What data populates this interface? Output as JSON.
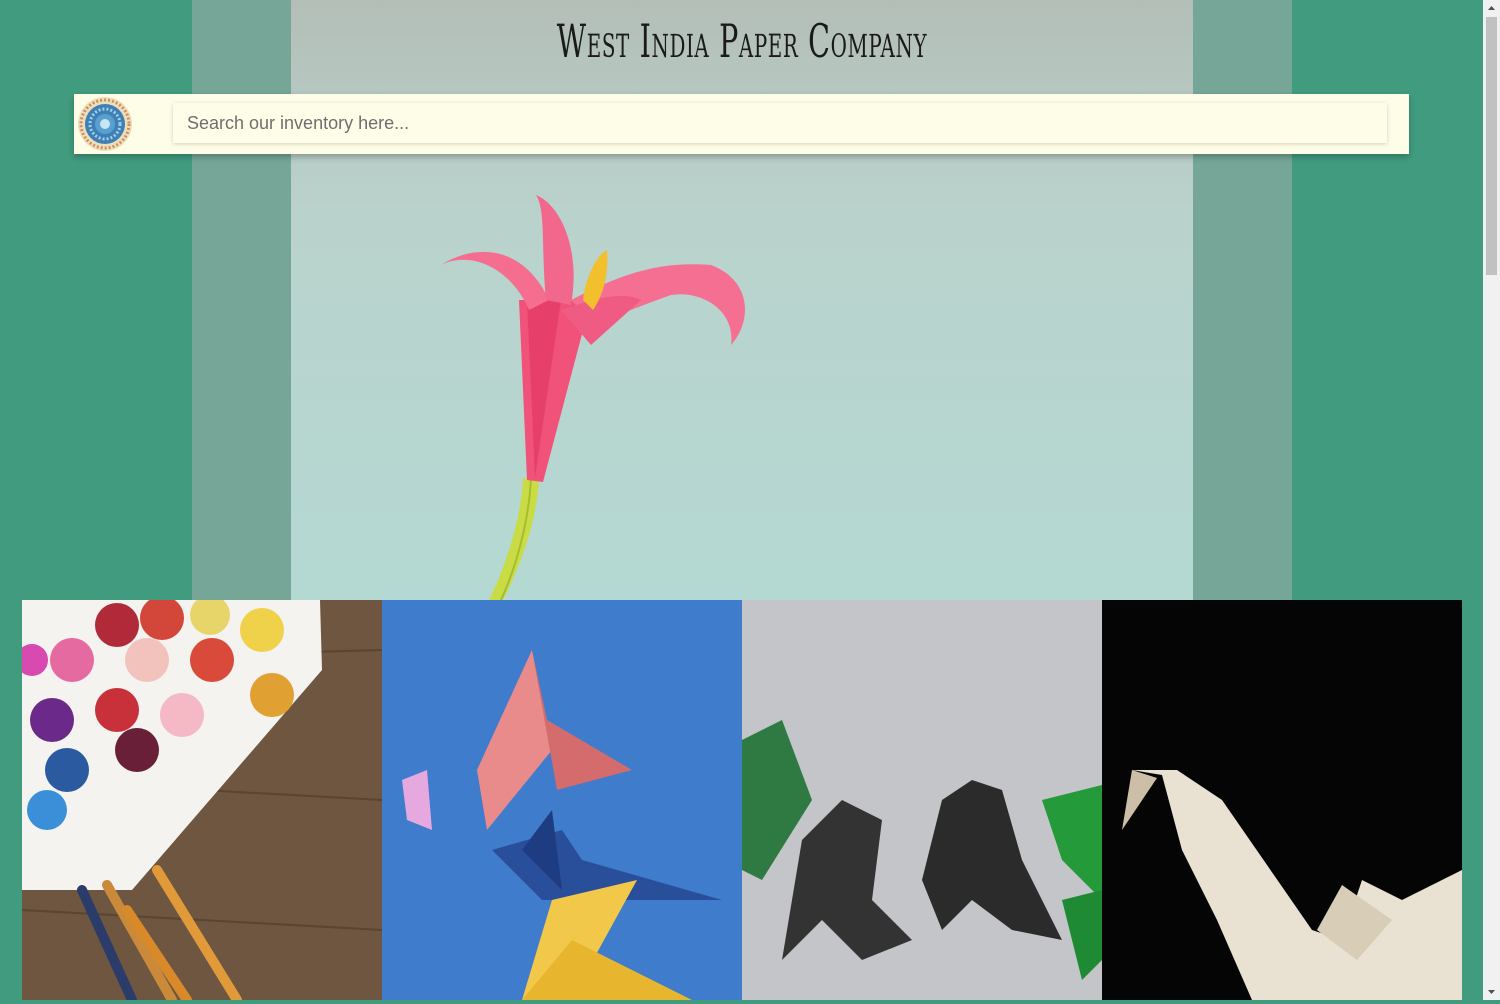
{
  "header": {
    "title": "West India Paper Company"
  },
  "search": {
    "placeholder": "Search our inventory here...",
    "value": ""
  },
  "icons": {
    "logo": "mandala-logo-icon",
    "scroll_up": "arrow-up-icon",
    "scroll_down": "arrow-down-icon"
  },
  "colors": {
    "page_background": "#419c7f",
    "hero_frame": "#75a697",
    "search_bar": "#fefde7"
  }
}
